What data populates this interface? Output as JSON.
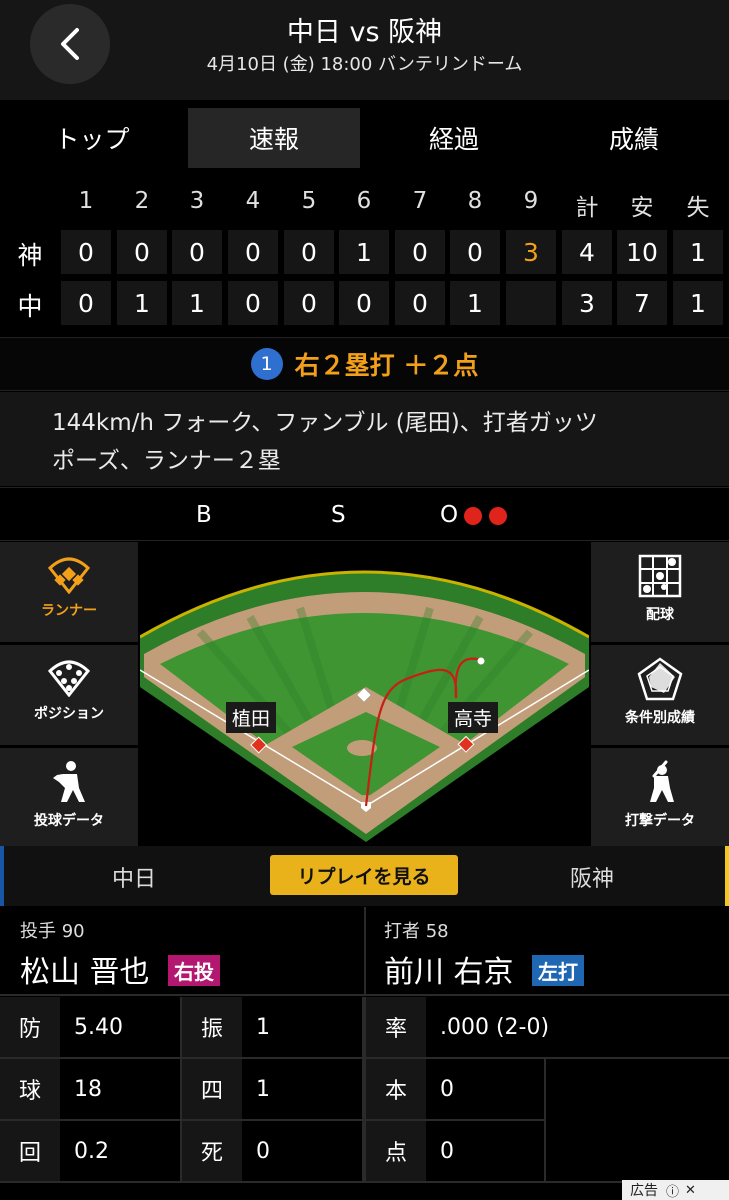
{
  "header": {
    "title": "中日 vs 阪神",
    "subtitle": "4月10日 (金) 18:00 バンテリンドーム"
  },
  "tabs": [
    {
      "label": "トップ"
    },
    {
      "label": "速報"
    },
    {
      "label": "経過"
    },
    {
      "label": "成績"
    }
  ],
  "scoreboard": {
    "headers": [
      "1",
      "2",
      "3",
      "4",
      "5",
      "6",
      "7",
      "8",
      "9",
      "計",
      "安",
      "失"
    ],
    "rows": [
      {
        "team": "神",
        "cells": [
          "0",
          "0",
          "0",
          "0",
          "0",
          "1",
          "0",
          "0",
          "3",
          "4",
          "10",
          "1"
        ]
      },
      {
        "team": "中",
        "cells": [
          "0",
          "1",
          "1",
          "0",
          "0",
          "0",
          "0",
          "1",
          "",
          "3",
          "7",
          "1"
        ]
      }
    ]
  },
  "play": {
    "number": "1",
    "text": "右２塁打 ＋２点",
    "description_line1": "144km/h フォーク、ファンブル (尾田)、打者ガッツ",
    "description_line2": "ポーズ、ランナー２塁"
  },
  "count": {
    "ball_label": "B",
    "strike_label": "S",
    "out_label": "O",
    "outs": 2
  },
  "side_left": [
    {
      "label": "ランナー",
      "icon": "diamond-icon"
    },
    {
      "label": "ポジション",
      "icon": "positions-icon"
    },
    {
      "label": "投球データ",
      "icon": "pitcher-icon"
    }
  ],
  "side_right": [
    {
      "label": "配球",
      "icon": "pitch-grid-icon"
    },
    {
      "label": "条件別成績",
      "icon": "radar-icon"
    },
    {
      "label": "打撃データ",
      "icon": "batter-icon"
    }
  ],
  "field": {
    "runner_first": "高寺",
    "runner_third": "植田"
  },
  "teams": {
    "left": "中日",
    "right": "阪神",
    "replay_label": "リプレイを見る"
  },
  "pitcher": {
    "role": "投手 90",
    "name": "松山 晋也",
    "badge": "右投"
  },
  "batter": {
    "role": "打者 58",
    "name": "前川 右京",
    "badge": "左打"
  },
  "pitcher_stats": [
    {
      "k1": "防",
      "v1": "5.40",
      "k2": "振",
      "v2": "1"
    },
    {
      "k1": "球",
      "v1": "18",
      "k2": "四",
      "v2": "1"
    },
    {
      "k1": "回",
      "v1": "0.2",
      "k2": "死",
      "v2": "0"
    }
  ],
  "batter_stats": [
    {
      "k": "率",
      "v": ".000 (2-0)"
    },
    {
      "k": "本",
      "v": "0"
    },
    {
      "k": "点",
      "v": "0"
    }
  ],
  "ad": {
    "label": "広告"
  },
  "colors": {
    "accent": "#f2a01a",
    "highlight_run": "#f2a01a",
    "out_dot": "#e0241c",
    "replay": "#e9b21a",
    "pitcher_badge": "#b3176f",
    "batter_badge": "#1f66b3"
  }
}
